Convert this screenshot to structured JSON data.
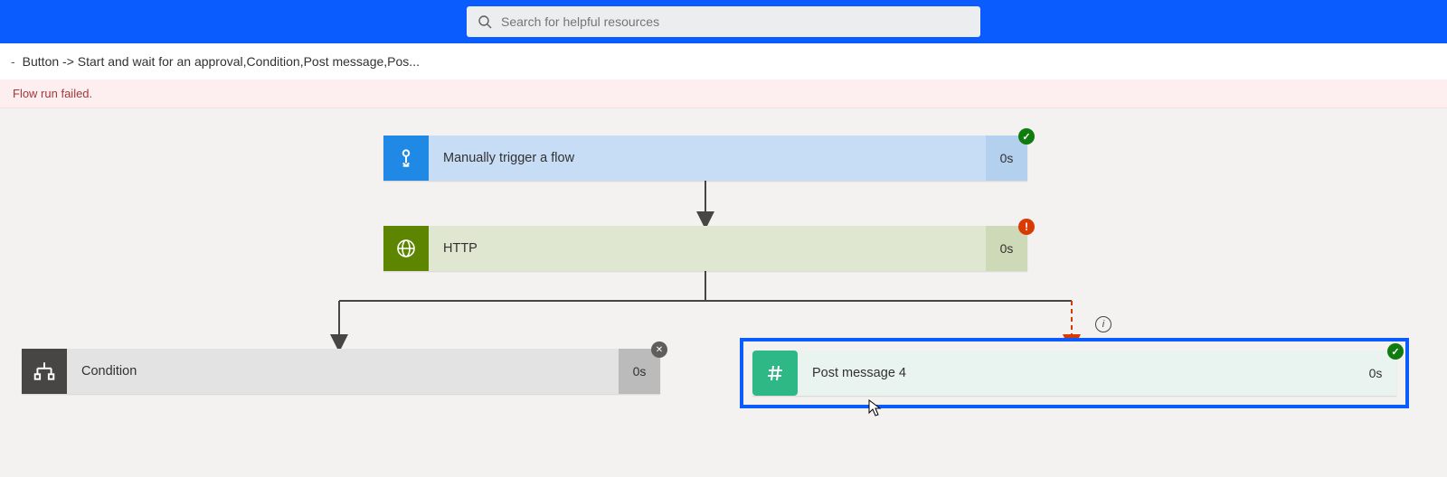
{
  "search": {
    "placeholder": "Search for helpful resources"
  },
  "breadcrumb": {
    "dash": "-",
    "title": "Button -> Start and wait for an approval,Condition,Post message,Pos..."
  },
  "banner": {
    "error_text": "Flow run failed."
  },
  "cards": {
    "trigger": {
      "title": "Manually trigger a flow",
      "duration": "0s"
    },
    "http": {
      "title": "HTTP",
      "duration": "0s"
    },
    "condition": {
      "title": "Condition",
      "duration": "0s"
    },
    "slack": {
      "title": "Post message 4",
      "duration": "0s"
    }
  },
  "status": {
    "trigger": "success",
    "http": "error",
    "condition": "cancelled",
    "slack": "success"
  },
  "info_icon_title": "Info",
  "colors": {
    "brand_blue": "#0a5cff",
    "error_bg": "#fdeff0",
    "error_text": "#a4373a",
    "success": "#107c10",
    "failure": "#d83b01"
  }
}
